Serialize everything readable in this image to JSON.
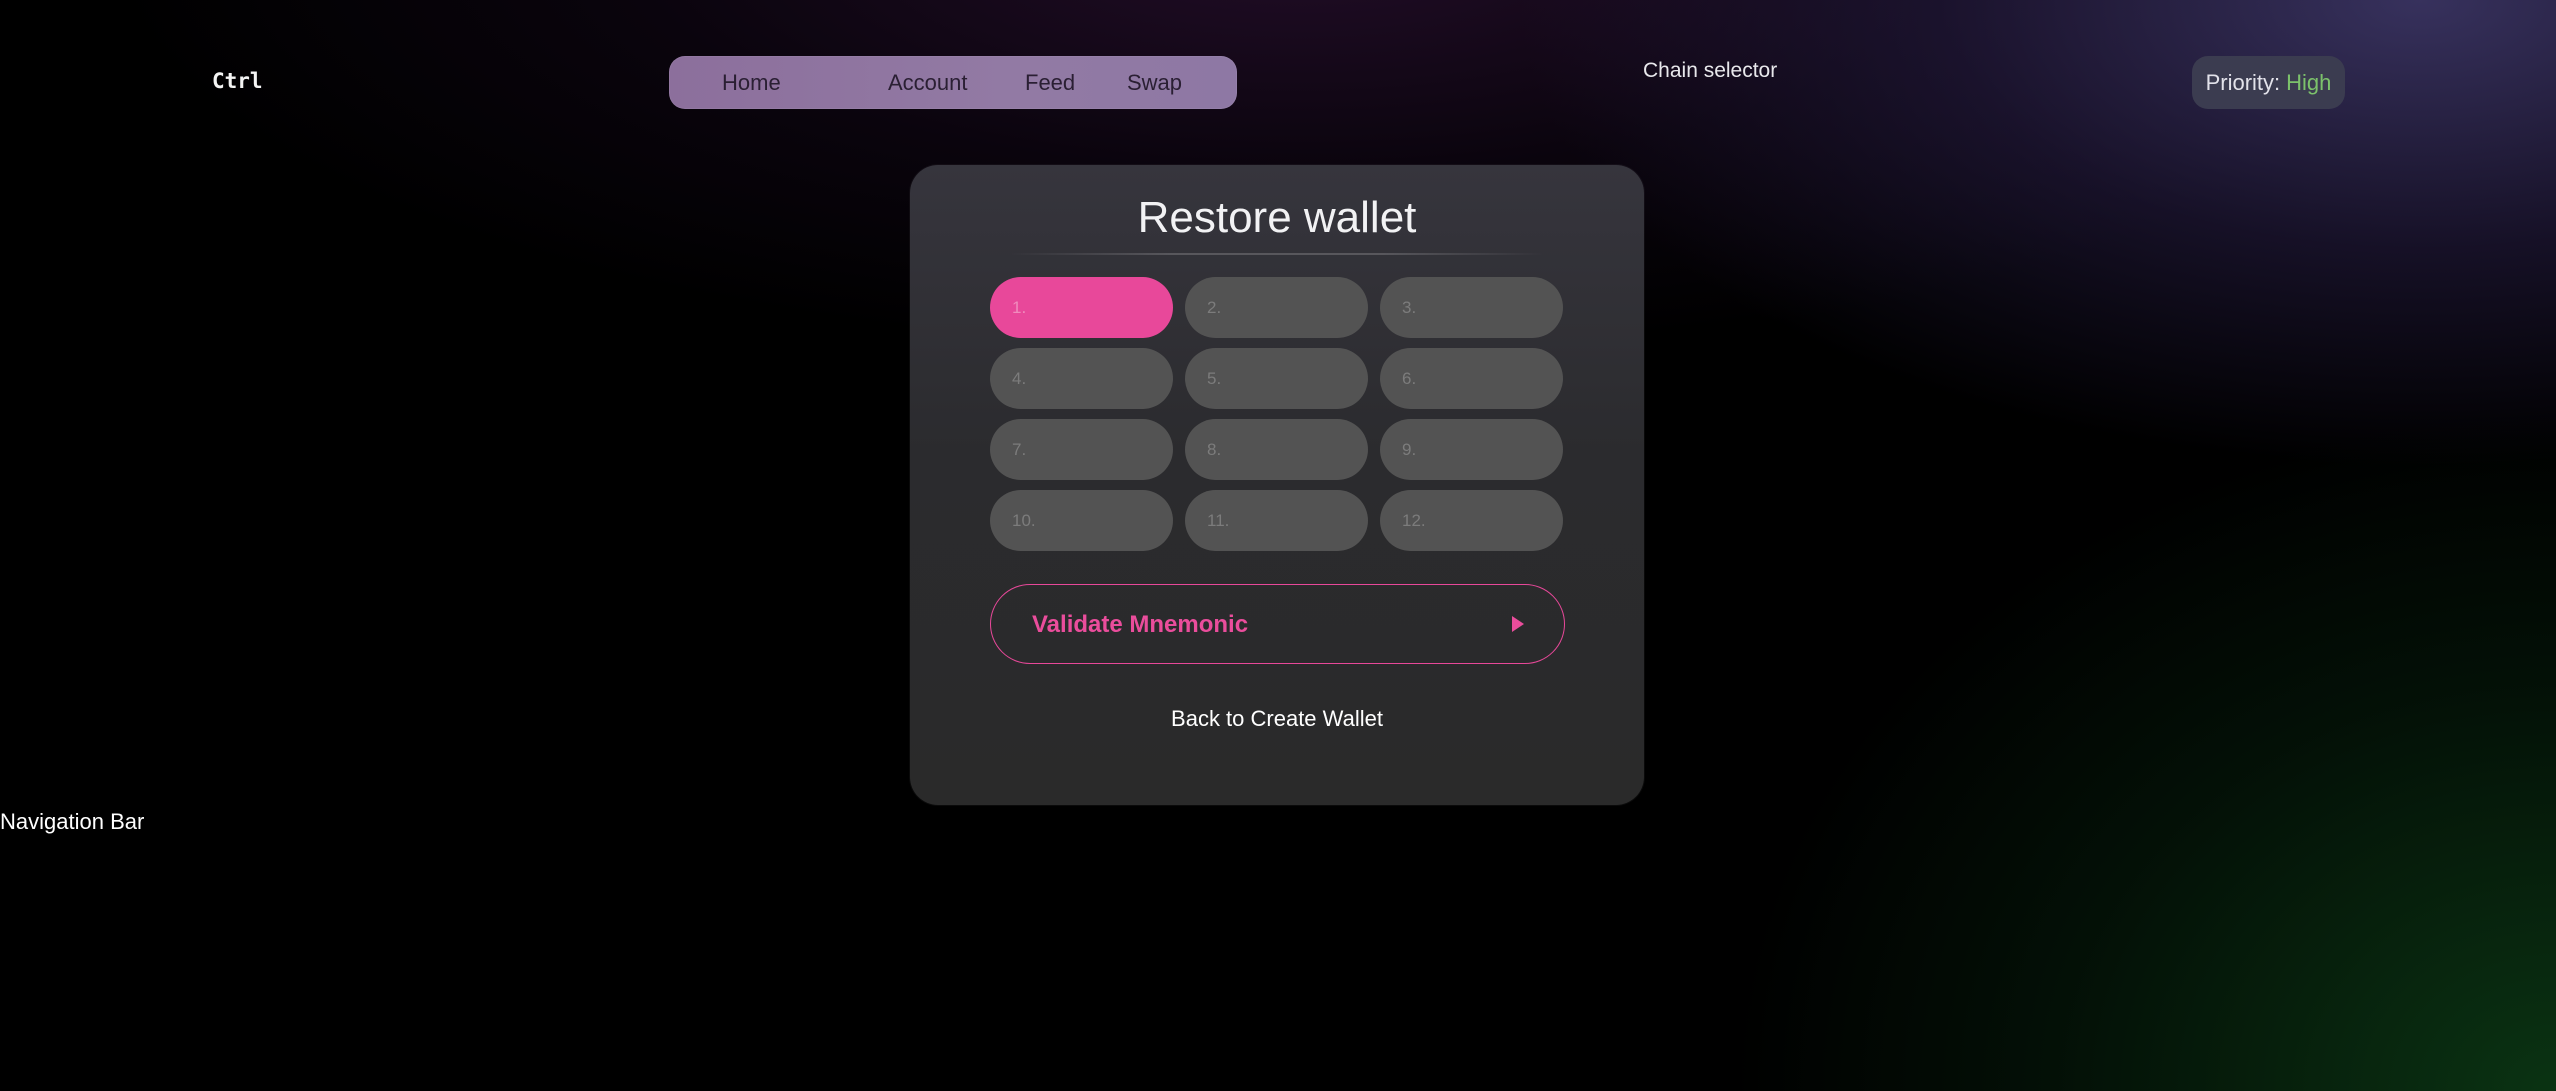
{
  "header": {
    "logo": "Ctrl",
    "nav": {
      "home": "Home",
      "account": "Account",
      "feed": "Feed",
      "swap": "Swap"
    },
    "chain_selector": "Chain selector",
    "priority": {
      "label": "Priority:",
      "value": "High"
    }
  },
  "card": {
    "title": "Restore wallet",
    "word_placeholders": [
      "1.",
      "2.",
      "3.",
      "4.",
      "5.",
      "6.",
      "7.",
      "8.",
      "9.",
      "10.",
      "11.",
      "12."
    ],
    "active_word_index": 0,
    "validate_button": "Validate Mnemonic",
    "back_link": "Back to Create Wallet"
  },
  "footer_label": "Navigation Bar",
  "colors": {
    "accent_pink": "#e8489a",
    "priority_high": "#7cc26b",
    "nav_pill": "#927aa4",
    "card_bg": "#2b2b2e",
    "word_input_bg": "#535353"
  }
}
